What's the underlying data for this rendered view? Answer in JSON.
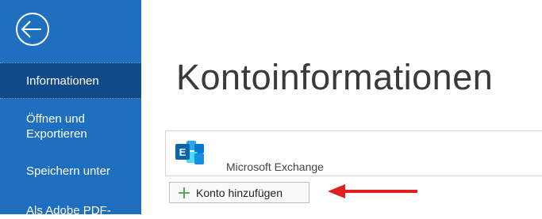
{
  "sidebar": {
    "back_icon": "arrow-left-circle-icon",
    "items": [
      {
        "label": "Informationen",
        "selected": true
      },
      {
        "label": "Öffnen und Exportieren"
      },
      {
        "label": "Speichern unter"
      },
      {
        "label": "Als Adobe PDF-"
      }
    ]
  },
  "main": {
    "title": "Kontoinformationen",
    "account": {
      "icon": "exchange-icon",
      "name": "Microsoft Exchange"
    },
    "add_account": {
      "icon": "plus-icon",
      "label": "Konto hinzufügen"
    },
    "annotation": {
      "icon": "red-arrow-icon",
      "color": "#e02020"
    }
  },
  "colors": {
    "sidebar": "#1f6fc0",
    "sidebar_selected": "#124b87",
    "plus": "#3a9a3a"
  }
}
